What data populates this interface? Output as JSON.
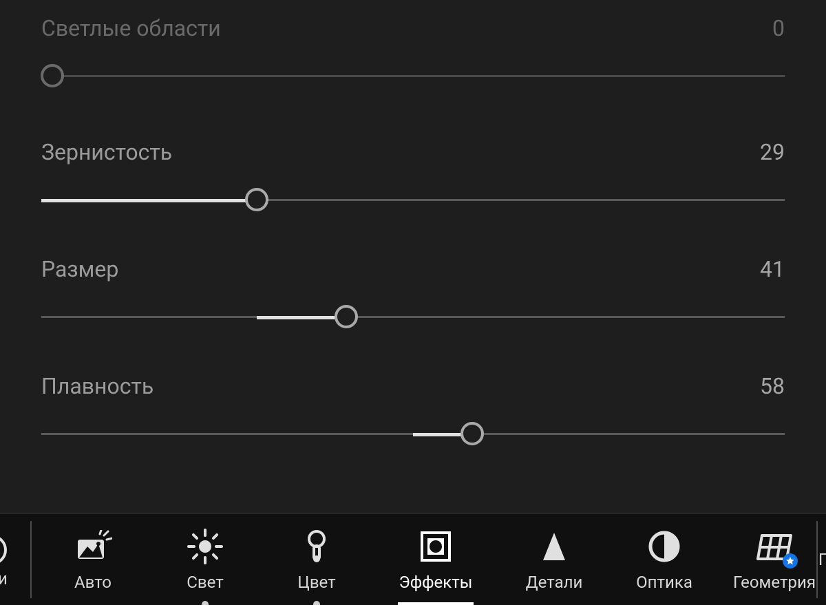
{
  "sliders": [
    {
      "key": "highlights",
      "label": "Светлые области",
      "value": 0,
      "min": 0,
      "max": 100,
      "dim": true,
      "fill_from_zero": false
    },
    {
      "key": "grain",
      "label": "Зернистость",
      "value": 29,
      "min": 0,
      "max": 100,
      "dim": false,
      "fill_from_zero": true
    },
    {
      "key": "size",
      "label": "Размер",
      "value": 41,
      "min": 0,
      "max": 100,
      "dim": false,
      "fill_from_zero": false,
      "fill_from_center": true
    },
    {
      "key": "smoothness",
      "label": "Плавность",
      "value": 58,
      "min": 0,
      "max": 100,
      "dim": false,
      "fill_from_zero": false,
      "fill_from_center": true
    }
  ],
  "tabs": {
    "partial_left_label": "ли",
    "partial_right_label": "П",
    "items": [
      {
        "key": "auto",
        "label": "Авто",
        "icon": "auto-icon",
        "dot": false
      },
      {
        "key": "light",
        "label": "Свет",
        "icon": "light-icon",
        "dot": true
      },
      {
        "key": "color",
        "label": "Цвет",
        "icon": "color-icon",
        "dot": true
      },
      {
        "key": "effects",
        "label": "Эффекты",
        "icon": "effects-icon",
        "dot": false,
        "active": true
      },
      {
        "key": "detail",
        "label": "Детали",
        "icon": "detail-icon",
        "dot": false
      },
      {
        "key": "optics",
        "label": "Оптика",
        "icon": "optics-icon",
        "dot": false
      },
      {
        "key": "geometry",
        "label": "Геометрия",
        "icon": "geometry-icon",
        "dot": false,
        "badge": true
      }
    ]
  },
  "colors": {
    "bg": "#1e1e1e",
    "bar": "#101010",
    "accent": "#1473e6"
  }
}
